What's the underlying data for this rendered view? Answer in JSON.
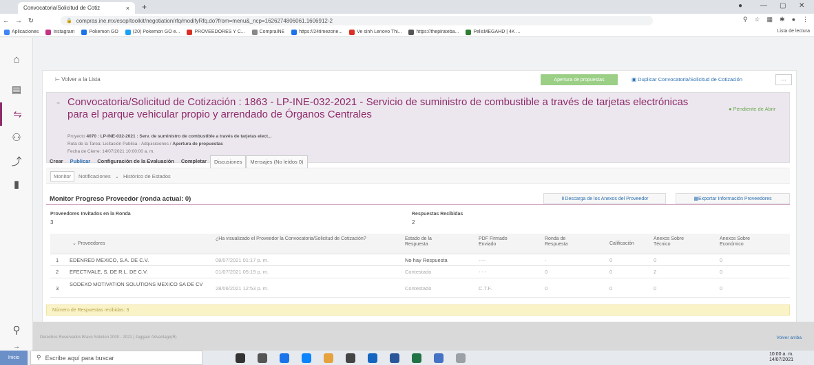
{
  "browser": {
    "tab_title": "Convocatoria/Solicitud de Cotiz",
    "tab_close": "×",
    "new_tab": "+",
    "url": "compras.ine.mx/esop/toolkit/negotiation/rfq/modifyRfq.do?from=menu&_ncp=1626274806061.1606912-2",
    "bookmarks": [
      "Aplicaciones",
      "Instagram",
      "Pokemon GO",
      "(20) Pokemon GO e...",
      "PROVEEDORES Y C...",
      "CompraINE",
      "https://24timezone...",
      "Ve sinh Lenovo Thi...",
      "https://thepirateba...",
      "PelisMEGAHD | 4K ..."
    ],
    "bookmark_colors": [
      "#d93025",
      "#c13584",
      "#1a73e8",
      "#1da1f2",
      "#d93025",
      "#888888",
      "#1a73e8",
      "#d93025",
      "#555555",
      "#2e7d32"
    ],
    "reading_list": "Lista de lectura"
  },
  "toolbar": {
    "back_to_list": "Volver a la Lista",
    "open_proposals": "Apertura de propuestas",
    "duplicate": "Duplicar Convocatoria/Solicitud de Cotización",
    "more": "···"
  },
  "header": {
    "title": "Convocatoria/Solicitud de Cotización : 1863 - LP-INE-032-2021 - Servicio de suministro de combustible a través de tarjetas electrónicas para el parque vehicular propio y arrendado de Órganos Centrales",
    "status": "Pendiente de Abrir",
    "project_label": "Proyecto",
    "project_value": "4070 : LP-INE-032-2021 : Serv. de suministro de combustible a través de tarjetas elect...",
    "route_label": "Ruta de la Tarea: Licitación Publica - Adquisiciones /",
    "route_value": "Apertura de propuestas",
    "close_date": "Fecha de Cierre: 14/07/2021 10:00:00 a. m."
  },
  "tabs": [
    {
      "label": "Crear",
      "style": "plain"
    },
    {
      "label": "Publicar",
      "style": "blue"
    },
    {
      "label": "Configuración de la Evaluación",
      "style": "plain"
    },
    {
      "label": "Completar",
      "style": "plain"
    },
    {
      "label": "Discusiones",
      "style": "boxed"
    },
    {
      "label": "Mensajes (No leídos 0)",
      "style": "boxed"
    }
  ],
  "subnav": {
    "monitor": "Monitor",
    "notifications": "Notificaciones",
    "chevron": "⌄",
    "history": "Histórico de Estados"
  },
  "monitor": {
    "title": "Monitor Progreso Proveedor (ronda actual: 0)",
    "download_button": "Descarga de los Anexos del Proveedor",
    "export_button": "Exportar Información Proveedores",
    "invited_label": "Proveedores Invitados en la Ronda",
    "invited_value": "3",
    "responses_label": "Respuestas Recibidas",
    "responses_value": "2"
  },
  "table": {
    "headers": [
      "Proveedores",
      "¿Ha visualizado el Proveedor la Convocatoria/Solicitud de Cotización?",
      "Estado de la Respuesta",
      "PDF Firmado Enviado",
      "Ronda de Respuesta",
      "Calificación",
      "Anexos Sobre Técnico",
      "Anexos Sobre Económico"
    ],
    "rows": [
      {
        "n": "1",
        "supplier": "EDENRED MEXICO, S.A. DE C.V.",
        "viewed": "08/07/2021 01:17 p. m.",
        "status": "No hay Respuesta",
        "pdf": "----",
        "round": "-",
        "score": "0",
        "tech": "0",
        "econ": "0"
      },
      {
        "n": "2",
        "supplier": "EFECTIVALE, S. DE R.L. DE C.V.",
        "viewed": "01/07/2021 05:19 p. m.",
        "status": "Contestado",
        "pdf": "- - -",
        "round": "0",
        "score": "0",
        "tech": "2",
        "econ": "0"
      },
      {
        "n": "3",
        "supplier": "SODEXO MOTIVATION SOLUTIONS MEXICO SA DE CV",
        "viewed": "28/06/2021 12:53 p. m.",
        "status": "Contestado",
        "pdf": "C.T.F.",
        "round": "0",
        "score": "0",
        "tech": "0",
        "econ": "0"
      }
    ],
    "footer": "Número de Respuestas recibidas: 3"
  },
  "page_footer": {
    "left": "Derechos Reservados Bravo Solution 2000 - 2021 | Jaggaer Advantage(R)",
    "right": "Volver arriba"
  },
  "taskbar": {
    "start": "Inicio",
    "search": "Escribe aquí para buscar",
    "time": "10:00 a. m.",
    "date": "14/07/2021",
    "app_colors": [
      "#333333",
      "#555555",
      "#1a73e8",
      "#0a84ff",
      "#e6a23c",
      "#444444",
      "#1565c0",
      "#2b579a",
      "#217346",
      "#4472c4",
      "#9aa0a6"
    ]
  }
}
